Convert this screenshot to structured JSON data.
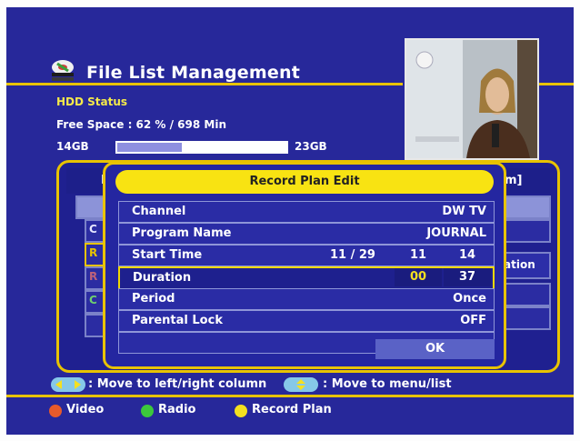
{
  "header": {
    "title": "File List Management"
  },
  "hdd": {
    "status_label": "HDD Status",
    "free_space": "Free Space : 62 % / 698 Min",
    "min_label": "14GB",
    "max_label": "23GB",
    "fill_fraction": 0.38
  },
  "background_list": {
    "left_tab_partial": "F",
    "right_tab_partial": "m]",
    "rows_partial": [
      "",
      "C",
      "R",
      "R",
      "C",
      ""
    ],
    "right_row_partial": "ation"
  },
  "dialog": {
    "title": "Record Plan Edit",
    "rows": [
      {
        "label": "Channel",
        "value": "DW TV"
      },
      {
        "label": "Program Name",
        "value": "JOURNAL"
      },
      {
        "label": "Start Time",
        "date": "11 / 29",
        "hour": "11",
        "minute": "14"
      },
      {
        "label": "Duration",
        "hours": "00",
        "minutes": "37"
      },
      {
        "label": "Period",
        "value": "Once"
      },
      {
        "label": "Parental Lock",
        "value": "OFF"
      }
    ],
    "ok_label": "OK"
  },
  "help": {
    "left_right": ": Move to left/right column",
    "menu_list": ": Move to menu/list"
  },
  "legend": {
    "video": "Video",
    "radio": "Radio",
    "record_plan": "Record Plan"
  },
  "colors": {
    "background": "#27289a",
    "accent_gold": "#e8c300",
    "title_yellow": "#f8e312",
    "video_dot": "#e85a2a",
    "radio_dot": "#3cc83c",
    "record_dot": "#f4e020"
  },
  "icons": {
    "title_icon": "disk-stack-icon",
    "help_left_right": "left-right-arrows-icon",
    "help_up_down": "up-down-arrows-icon"
  }
}
